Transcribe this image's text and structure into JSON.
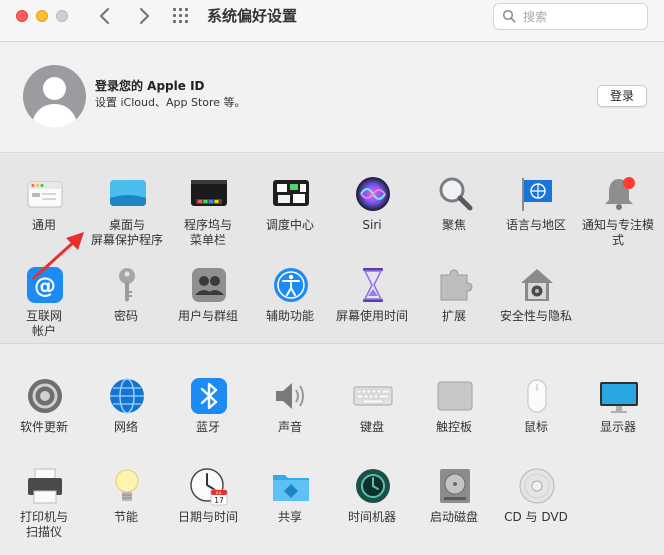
{
  "window": {
    "title": "系统偏好设置"
  },
  "search": {
    "placeholder": "搜索"
  },
  "account": {
    "title": "登录您的 Apple ID",
    "subtitle": "设置 iCloud、App Store 等。",
    "login_label": "登录"
  },
  "row1": [
    {
      "label": "通用",
      "icon": "general-icon"
    },
    {
      "label1": "桌面与",
      "label2": "屏幕保护程序",
      "icon": "desktop-screensaver-icon"
    },
    {
      "label1": "程序坞与",
      "label2": "菜单栏",
      "icon": "dock-menubar-icon"
    },
    {
      "label": "调度中心",
      "icon": "mission-control-icon"
    },
    {
      "label": "Siri",
      "icon": "siri-icon"
    },
    {
      "label": "聚焦",
      "icon": "spotlight-icon"
    },
    {
      "label": "语言与地区",
      "icon": "language-region-icon"
    },
    {
      "label": "通知与专注模式",
      "icon": "notifications-icon"
    }
  ],
  "row2": [
    {
      "label1": "互联网",
      "label2": "帐户",
      "icon": "internet-accounts-icon"
    },
    {
      "label": "密码",
      "icon": "passwords-icon"
    },
    {
      "label": "用户与群组",
      "icon": "users-groups-icon"
    },
    {
      "label": "辅助功能",
      "icon": "accessibility-icon"
    },
    {
      "label": "屏幕使用时间",
      "icon": "screen-time-icon"
    },
    {
      "label": "扩展",
      "icon": "extensions-icon"
    },
    {
      "label": "安全性与隐私",
      "icon": "security-privacy-icon"
    }
  ],
  "row3": [
    {
      "label": "软件更新",
      "icon": "software-update-icon"
    },
    {
      "label": "网络",
      "icon": "network-icon"
    },
    {
      "label": "蓝牙",
      "icon": "bluetooth-icon"
    },
    {
      "label": "声音",
      "icon": "sound-icon"
    },
    {
      "label": "键盘",
      "icon": "keyboard-icon"
    },
    {
      "label": "触控板",
      "icon": "trackpad-icon"
    },
    {
      "label": "鼠标",
      "icon": "mouse-icon"
    },
    {
      "label": "显示器",
      "icon": "displays-icon"
    }
  ],
  "row4": [
    {
      "label1": "打印机与",
      "label2": "扫描仪",
      "icon": "printers-scanners-icon"
    },
    {
      "label": "节能",
      "icon": "energy-saver-icon"
    },
    {
      "label": "日期与时间",
      "icon": "date-time-icon"
    },
    {
      "label": "共享",
      "icon": "sharing-icon"
    },
    {
      "label": "时间机器",
      "icon": "time-machine-icon"
    },
    {
      "label": "启动磁盘",
      "icon": "startup-disk-icon"
    },
    {
      "label": "CD 与 DVD",
      "icon": "cd-dvd-icon"
    }
  ],
  "calendar": {
    "month": "JUL",
    "day": "17"
  },
  "colors": {
    "accent": "#1e8bf5",
    "close": "#fe5f57",
    "minimize": "#febc2e",
    "arrow": "#e8312f"
  }
}
